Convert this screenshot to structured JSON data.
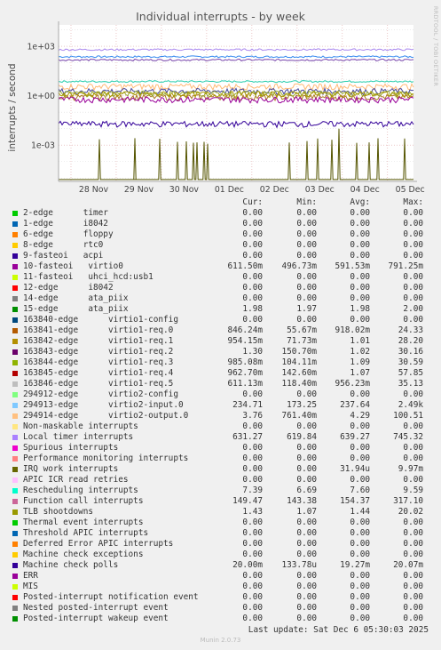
{
  "title": "Individual interrupts - by week",
  "ylabel": "interrupts / second",
  "side_label": "RRDTOOL / TOBI OETIKER",
  "footer": "Last update: Sat Dec  6 05:30:03 2025",
  "munin_version": "Munin 2.0.73",
  "headers": {
    "cur": "Cur:",
    "min": "Min:",
    "avg": "Avg:",
    "max": "Max:"
  },
  "chart_data": {
    "type": "line",
    "title": "Individual interrupts - by week",
    "ylabel": "interrupts / second",
    "y_scale": "log",
    "y_ticks": [
      {
        "value": 1000,
        "label": "1e+03"
      },
      {
        "value": 1,
        "label": "1e+00"
      },
      {
        "value": 0.001,
        "label": "1e-03"
      }
    ],
    "ylim": [
      6.3e-06,
      20000
    ],
    "x_ticks": [
      "28 Nov",
      "29 Nov",
      "30 Nov",
      "01 Dec",
      "02 Dec",
      "03 Dec",
      "04 Dec",
      "05 Dec"
    ],
    "grid": true,
    "series_levels": [
      {
        "name": "virtio2-input.0",
        "color": "#3388ee",
        "value": 234.71
      },
      {
        "name": "Rescheduling interrupts",
        "color": "#22ccaa",
        "value": 7.39
      },
      {
        "name": "Function call interrupts",
        "color": "#7744aa",
        "value": 149.47
      },
      {
        "name": "Local timer interrupts",
        "color": "#aa88ee",
        "value": 631.27
      },
      {
        "name": "virtio1-req.0",
        "color": "#aa7722",
        "value": 0.846
      },
      {
        "name": "virtio2-output.0",
        "color": "#ffbb77",
        "value": 3.76
      },
      {
        "name": "15-edge ata_piix",
        "color": "#444499",
        "value": 1.98
      },
      {
        "name": "TLB shootdowns",
        "color": "#99aa33",
        "value": 1.43
      },
      {
        "name": "10-fasteoi virtio0",
        "color": "#990099",
        "value": 0.6115
      },
      {
        "name": "virtio1-req.2",
        "color": "#aa9900",
        "value": 1.3
      },
      {
        "name": "Machine check polls",
        "color": "#330099",
        "value": 0.02
      },
      {
        "name": "IRQ work interrupts",
        "color": "#555500",
        "value": 3.19e-05,
        "spikes_to": 0.00997
      }
    ]
  },
  "legend": [
    {
      "name": "2-edge      timer",
      "color": "#00cc00",
      "cur": "0.00",
      "min": "0.00",
      "avg": "0.00",
      "max": "0.00"
    },
    {
      "name": "1-edge      i8042",
      "color": "#0066b3",
      "cur": "0.00",
      "min": "0.00",
      "avg": "0.00",
      "max": "0.00"
    },
    {
      "name": "6-edge      floppy",
      "color": "#ff8000",
      "cur": "0.00",
      "min": "0.00",
      "avg": "0.00",
      "max": "0.00"
    },
    {
      "name": "8-edge      rtc0",
      "color": "#ffcc00",
      "cur": "0.00",
      "min": "0.00",
      "avg": "0.00",
      "max": "0.00"
    },
    {
      "name": "9-fasteoi   acpi",
      "color": "#330099",
      "cur": "0.00",
      "min": "0.00",
      "avg": "0.00",
      "max": "0.00"
    },
    {
      "name": "10-fasteoi   virtio0",
      "color": "#990099",
      "cur": "611.50m",
      "min": "496.73m",
      "avg": "591.53m",
      "max": "791.25m"
    },
    {
      "name": "11-fasteoi   uhci_hcd:usb1",
      "color": "#ccff00",
      "cur": "0.00",
      "min": "0.00",
      "avg": "0.00",
      "max": "0.00"
    },
    {
      "name": "12-edge      i8042",
      "color": "#ff0000",
      "cur": "0.00",
      "min": "0.00",
      "avg": "0.00",
      "max": "0.00"
    },
    {
      "name": "14-edge      ata_piix",
      "color": "#808080",
      "cur": "0.00",
      "min": "0.00",
      "avg": "0.00",
      "max": "0.00"
    },
    {
      "name": "15-edge      ata_piix",
      "color": "#008f00",
      "cur": "1.98",
      "min": "1.97",
      "avg": "1.98",
      "max": "2.00"
    },
    {
      "name": "163840-edge      virtio1-config",
      "color": "#00487d",
      "cur": "0.00",
      "min": "0.00",
      "avg": "0.00",
      "max": "0.00"
    },
    {
      "name": "163841-edge      virtio1-req.0",
      "color": "#b35a00",
      "cur": "846.24m",
      "min": "55.67m",
      "avg": "918.02m",
      "max": "24.33"
    },
    {
      "name": "163842-edge      virtio1-req.1",
      "color": "#b38f00",
      "cur": "954.15m",
      "min": "71.73m",
      "avg": "1.01",
      "max": "28.20"
    },
    {
      "name": "163843-edge      virtio1-req.2",
      "color": "#6b006b",
      "cur": "1.30",
      "min": "150.70m",
      "avg": "1.02",
      "max": "30.16"
    },
    {
      "name": "163844-edge      virtio1-req.3",
      "color": "#8fb300",
      "cur": "985.08m",
      "min": "104.11m",
      "avg": "1.09",
      "max": "30.59"
    },
    {
      "name": "163845-edge      virtio1-req.4",
      "color": "#b30000",
      "cur": "962.70m",
      "min": "142.60m",
      "avg": "1.07",
      "max": "57.85"
    },
    {
      "name": "163846-edge      virtio1-req.5",
      "color": "#bebebe",
      "cur": "611.13m",
      "min": "118.40m",
      "avg": "956.23m",
      "max": "35.13"
    },
    {
      "name": "294912-edge      virtio2-config",
      "color": "#80ff80",
      "cur": "0.00",
      "min": "0.00",
      "avg": "0.00",
      "max": "0.00"
    },
    {
      "name": "294913-edge      virtio2-input.0",
      "color": "#80c9ff",
      "cur": "234.71",
      "min": "173.25",
      "avg": "237.64",
      "max": "2.49k"
    },
    {
      "name": "294914-edge      virtio2-output.0",
      "color": "#ffc080",
      "cur": "3.76",
      "min": "761.40m",
      "avg": "4.29",
      "max": "100.51"
    },
    {
      "name": "Non-maskable interrupts",
      "color": "#ffe680",
      "cur": "0.00",
      "min": "0.00",
      "avg": "0.00",
      "max": "0.00"
    },
    {
      "name": "Local timer interrupts",
      "color": "#aa80ff",
      "cur": "631.27",
      "min": "619.84",
      "avg": "639.27",
      "max": "745.32"
    },
    {
      "name": "Spurious interrupts",
      "color": "#ee00cc",
      "cur": "0.00",
      "min": "0.00",
      "avg": "0.00",
      "max": "0.00"
    },
    {
      "name": "Performance monitoring interrupts",
      "color": "#ff8080",
      "cur": "0.00",
      "min": "0.00",
      "avg": "0.00",
      "max": "0.00"
    },
    {
      "name": "IRQ work interrupts",
      "color": "#666600",
      "cur": "0.00",
      "min": "0.00",
      "avg": "31.94u",
      "max": "9.97m"
    },
    {
      "name": "APIC ICR read retries",
      "color": "#ffbfff",
      "cur": "0.00",
      "min": "0.00",
      "avg": "0.00",
      "max": "0.00"
    },
    {
      "name": "Rescheduling interrupts",
      "color": "#00ffcc",
      "cur": "7.39",
      "min": "6.69",
      "avg": "7.60",
      "max": "9.59"
    },
    {
      "name": "Function call interrupts",
      "color": "#cc6699",
      "cur": "149.47",
      "min": "143.38",
      "avg": "154.37",
      "max": "317.10"
    },
    {
      "name": "TLB shootdowns",
      "color": "#999900",
      "cur": "1.43",
      "min": "1.07",
      "avg": "1.44",
      "max": "20.02"
    },
    {
      "name": "Thermal event interrupts",
      "color": "#00cc00",
      "cur": "0.00",
      "min": "0.00",
      "avg": "0.00",
      "max": "0.00"
    },
    {
      "name": "Threshold APIC interrupts",
      "color": "#0066b3",
      "cur": "0.00",
      "min": "0.00",
      "avg": "0.00",
      "max": "0.00"
    },
    {
      "name": "Deferred Error APIC interrupts",
      "color": "#ff8000",
      "cur": "0.00",
      "min": "0.00",
      "avg": "0.00",
      "max": "0.00"
    },
    {
      "name": "Machine check exceptions",
      "color": "#ffcc00",
      "cur": "0.00",
      "min": "0.00",
      "avg": "0.00",
      "max": "0.00"
    },
    {
      "name": "Machine check polls",
      "color": "#330099",
      "cur": "20.00m",
      "min": "133.78u",
      "avg": "19.27m",
      "max": "20.07m"
    },
    {
      "name": "ERR",
      "color": "#990099",
      "cur": "0.00",
      "min": "0.00",
      "avg": "0.00",
      "max": "0.00"
    },
    {
      "name": "MIS",
      "color": "#ccff00",
      "cur": "0.00",
      "min": "0.00",
      "avg": "0.00",
      "max": "0.00"
    },
    {
      "name": "Posted-interrupt notification event",
      "color": "#ff0000",
      "cur": "0.00",
      "min": "0.00",
      "avg": "0.00",
      "max": "0.00"
    },
    {
      "name": "Nested posted-interrupt event",
      "color": "#808080",
      "cur": "0.00",
      "min": "0.00",
      "avg": "0.00",
      "max": "0.00"
    },
    {
      "name": "Posted-interrupt wakeup event",
      "color": "#008f00",
      "cur": "0.00",
      "min": "0.00",
      "avg": "0.00",
      "max": "0.00"
    }
  ]
}
